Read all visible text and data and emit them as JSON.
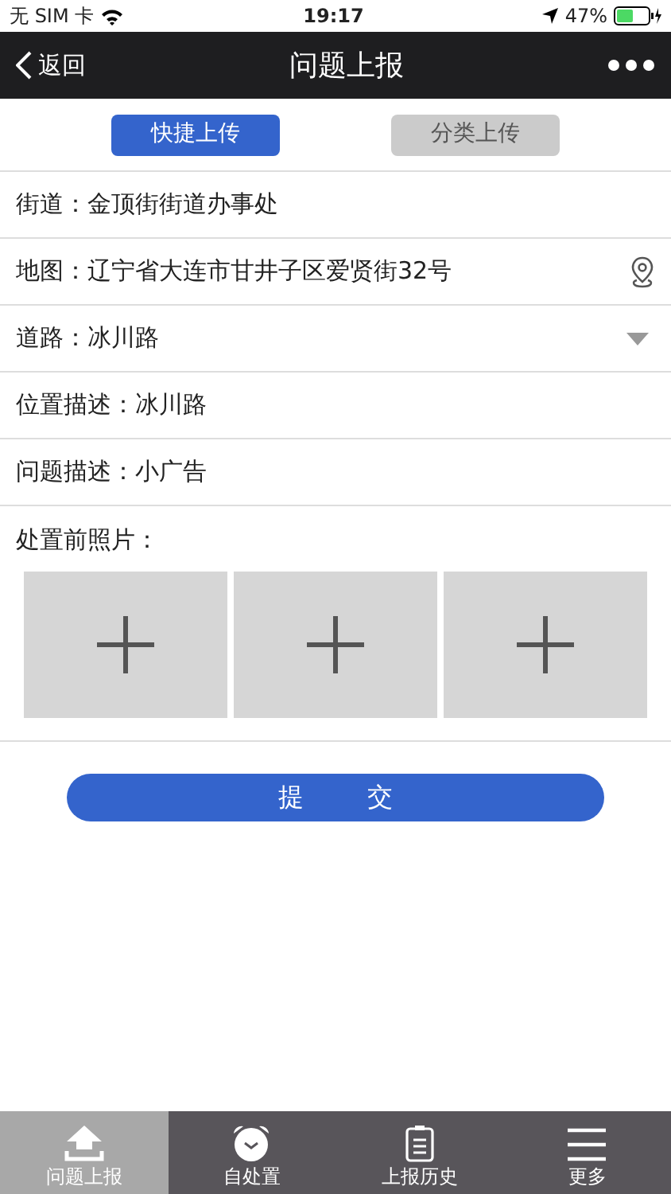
{
  "status_bar": {
    "carrier": "无 SIM 卡",
    "time": "19:17",
    "battery": "47%"
  },
  "nav": {
    "back": "返回",
    "title": "问题上报"
  },
  "tabs": [
    {
      "label": "快捷上传",
      "selected": true
    },
    {
      "label": "分类上传",
      "selected": false
    }
  ],
  "fields": [
    {
      "kind": "text",
      "label": "街道：",
      "value": "金顶街街道办事处"
    },
    {
      "kind": "map",
      "label": "地图：",
      "value": "辽宁省大连市甘井子区爱贤街32号"
    },
    {
      "kind": "select",
      "label": "道路：",
      "value": "冰川路"
    },
    {
      "kind": "text",
      "label": "位置描述：",
      "value": "冰川路"
    },
    {
      "kind": "text",
      "label": "问题描述：",
      "value": "小广告"
    }
  ],
  "photos": {
    "label": "处置前照片：",
    "slots": [
      {
        "kind": "add"
      },
      {
        "kind": "add"
      },
      {
        "kind": "add"
      }
    ]
  },
  "submit": "提 交",
  "bottom_tabs": [
    {
      "kind": "upload",
      "label": "问题上报",
      "selected": true
    },
    {
      "kind": "clock",
      "label": "自处置",
      "selected": false
    },
    {
      "kind": "clipboard",
      "label": "上报历史",
      "selected": false
    },
    {
      "kind": "menu",
      "label": "更多",
      "selected": false
    }
  ]
}
